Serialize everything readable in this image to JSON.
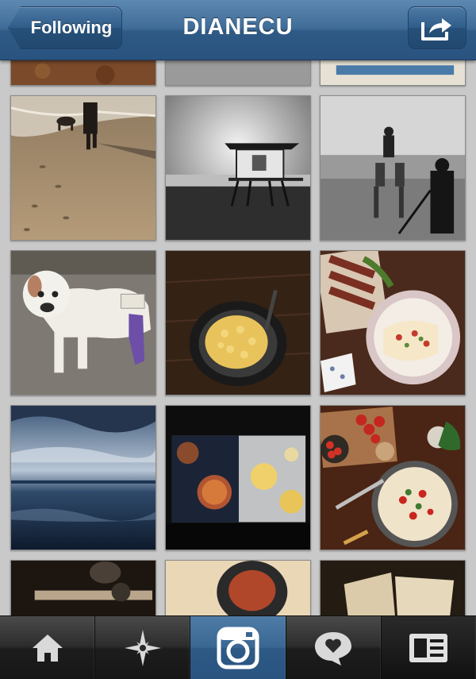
{
  "header": {
    "back_label": "Following",
    "title": "DIANECU",
    "share_icon": "share-arrow-icon"
  },
  "grid": {
    "rows": 5,
    "columns": 3,
    "visible_rows": "partial top row, 3 full rows, partial bottom row"
  },
  "tabbar": {
    "items": [
      {
        "icon": "home-icon",
        "active": false
      },
      {
        "icon": "explore-star-icon",
        "active": false
      },
      {
        "icon": "camera-icon",
        "active": true
      },
      {
        "icon": "news-heart-bubble-icon",
        "active": false
      },
      {
        "icon": "profile-card-icon",
        "active": false
      }
    ],
    "active_color": "#2f5a85"
  },
  "colors": {
    "header_blue": "#3f6c97",
    "background": "#c9c9c9"
  }
}
